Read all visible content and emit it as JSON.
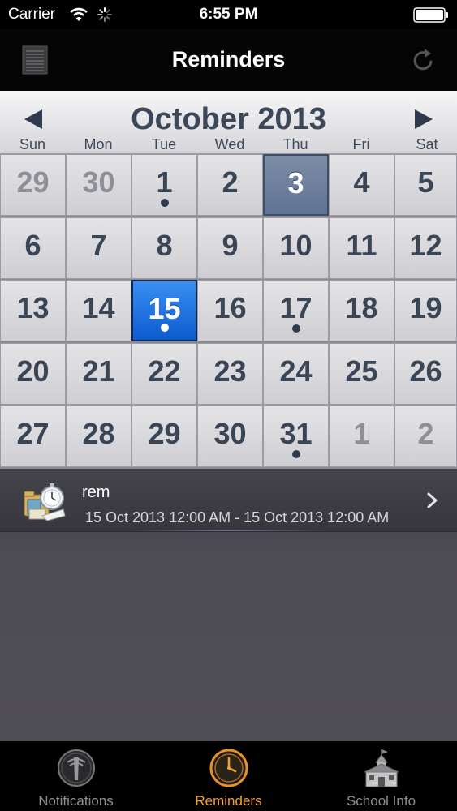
{
  "status_bar": {
    "carrier": "Carrier",
    "time": "6:55 PM"
  },
  "nav": {
    "title": "Reminders"
  },
  "calendar": {
    "month_title": "October 2013",
    "weekdays": [
      "Sun",
      "Mon",
      "Tue",
      "Wed",
      "Thu",
      "Fri",
      "Sat"
    ],
    "weeks": [
      [
        {
          "d": "29",
          "other": true
        },
        {
          "d": "30",
          "other": true
        },
        {
          "d": "1",
          "dot": true
        },
        {
          "d": "2"
        },
        {
          "d": "3",
          "today": true
        },
        {
          "d": "4"
        },
        {
          "d": "5"
        }
      ],
      [
        {
          "d": "6"
        },
        {
          "d": "7"
        },
        {
          "d": "8"
        },
        {
          "d": "9"
        },
        {
          "d": "10"
        },
        {
          "d": "11"
        },
        {
          "d": "12"
        }
      ],
      [
        {
          "d": "13"
        },
        {
          "d": "14"
        },
        {
          "d": "15",
          "selected": true,
          "dot": true
        },
        {
          "d": "16"
        },
        {
          "d": "17",
          "dot": true
        },
        {
          "d": "18"
        },
        {
          "d": "19"
        }
      ],
      [
        {
          "d": "20"
        },
        {
          "d": "21"
        },
        {
          "d": "22"
        },
        {
          "d": "23"
        },
        {
          "d": "24"
        },
        {
          "d": "25"
        },
        {
          "d": "26"
        }
      ],
      [
        {
          "d": "27"
        },
        {
          "d": "28"
        },
        {
          "d": "29"
        },
        {
          "d": "30"
        },
        {
          "d": "31",
          "dot": true
        },
        {
          "d": "1",
          "other": true
        },
        {
          "d": "2",
          "other": true
        }
      ]
    ]
  },
  "reminders": [
    {
      "title": "rem",
      "date_range": "15 Oct 2013 12:00 AM - 15 Oct 2013 12:00 AM"
    }
  ],
  "tabs": [
    {
      "label": "Notifications",
      "icon": "antenna-icon",
      "active": false
    },
    {
      "label": "Reminders",
      "icon": "clock-icon",
      "active": true
    },
    {
      "label": "School Info",
      "icon": "school-icon",
      "active": false
    }
  ],
  "colors": {
    "accent": "#f5a030",
    "selected_day": "#0d5bd1",
    "today_day": "#6a7d9c"
  }
}
